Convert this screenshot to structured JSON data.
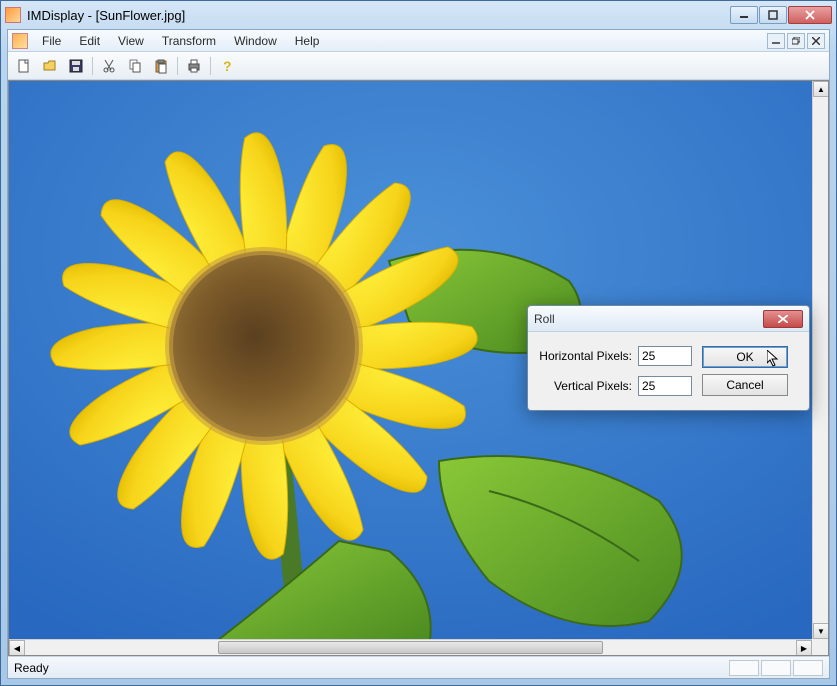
{
  "window": {
    "title": "IMDisplay - [SunFlower.jpg]"
  },
  "menu": {
    "file": "File",
    "edit": "Edit",
    "view": "View",
    "transform": "Transform",
    "window": "Window",
    "help": "Help"
  },
  "toolbar": {
    "new": "new-file-icon",
    "open": "open-folder-icon",
    "save": "save-disk-icon",
    "cut": "cut-scissors-icon",
    "copy": "copy-icon",
    "paste": "paste-icon",
    "print": "print-icon",
    "help": "help-question-icon"
  },
  "dialog": {
    "title": "Roll",
    "horizontal_label": "Horizontal Pixels:",
    "horizontal_value": "25",
    "vertical_label": "Vertical Pixels:",
    "vertical_value": "25",
    "ok_label": "OK",
    "cancel_label": "Cancel"
  },
  "statusbar": {
    "text": "Ready"
  }
}
